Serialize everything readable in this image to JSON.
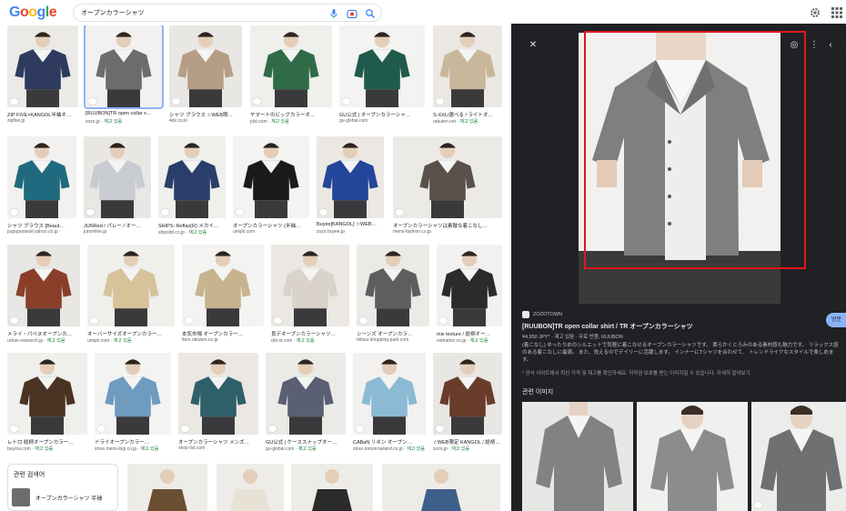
{
  "header": {
    "search_query": "オープンカラーシャツ",
    "icons": [
      "mic-icon",
      "camera-lens-icon",
      "search-icon",
      "settings-icon",
      "apps-icon"
    ]
  },
  "grid": {
    "rows": [
      [
        {
          "caption": "ZIP FIVE×KANGOL半袖オ…",
          "source": "zipfive.jp",
          "stock": ""
        },
        {
          "caption": "[RUUBON]TR open collar s…",
          "source": "zozo.jp · ",
          "stock": "재고 있음"
        },
        {
          "caption": "シャツ ブラウス ☆WEB限…",
          "source": "4dx.co.kr",
          "stock": ""
        },
        {
          "caption": "ヤマートのビッグカラーオ…",
          "source": "plst.com · ",
          "stock": "재고 있음"
        },
        {
          "caption": "GU公式 | オープンカラーシャ…",
          "source": "gu-global.com",
          "stock": ""
        },
        {
          "caption": "S-XXL/選べる / ライトオ…",
          "source": "rakuten.net · ",
          "stock": "재고 있음"
        }
      ],
      [
        {
          "caption": "シャツ ブラウス [Beaut…",
          "source": "pupuparasoil.yahoo.co.jp · ",
          "stock": ""
        },
        {
          "caption": "JUNRed / パレー / オー…",
          "source": "junonline.jp",
          "stock": ""
        },
        {
          "caption": "SHIPS: Reflax(R) メカイ…",
          "source": "shipsltd.co.jp · ",
          "stock": "재고 있음"
        },
        {
          "caption": "オープンカラーシャツ (半袖…",
          "source": "uniqlo.com",
          "stock": ""
        },
        {
          "caption": "Buyee[KANGOL] ☆WEB…",
          "source": "zozo.buyee.jp",
          "stock": ""
        },
        {
          "caption": "オープンカラーシャツは素敵な着こなし…",
          "source": "mens-fashion.co.jp",
          "stock": ""
        }
      ],
      [
        {
          "caption": "メライ・パペヌオープンカ…",
          "source": "urban-research.jp · ",
          "stock": "재고 있음"
        },
        {
          "caption": "オーバーサイズオープンカラー…",
          "source": "uniqlo.com · ",
          "stock": "재고 있음"
        },
        {
          "caption": "本気市場 オープンカラー…",
          "source": "item.rakuten.co.jp",
          "stock": ""
        },
        {
          "caption": "良デオープンカラーシャツ…",
          "source": "dot-st.com · ",
          "stock": "재고 있음"
        },
        {
          "caption": "シーンズ オープンカラ…",
          "source": "mitsui-shopping-park.com",
          "stock": ""
        },
        {
          "caption": "mix texture / 総柄オー…",
          "source": "estnation.co.jp · ",
          "stock": "재고 있음"
        }
      ],
      [
        {
          "caption": "レトロ 総柄オープンカラー…",
          "source": "buyma.com · ",
          "stock": "재고 있음"
        },
        {
          "caption": "ドライオープンカラー…",
          "source": "store.mens-bigi.co.jp · ",
          "stock": "재고 있음"
        },
        {
          "caption": "オープンカラーシャツ メンズ…",
          "source": "shop-list.com",
          "stock": ""
        },
        {
          "caption": "GU公式 | ケーススナップオー…",
          "source": "gu-global.com · ",
          "stock": "재고 있음"
        },
        {
          "caption": "CABaN リネン オープン…",
          "source": "store.tomorrowland.co.jp · ",
          "stock": "재고 있음"
        },
        {
          "caption": "☆WEB限定 KANGOL / 総柄…",
          "source": "zozo.jp · ",
          "stock": "재고 있음"
        }
      ]
    ],
    "related_label": "관련 검색어",
    "related_item": "オープンカラーシャツ 半袖"
  },
  "panel": {
    "site_name": "ZOZOTOWN",
    "title": "[RUUBON]TR open collar shirt / TR オープンカラーシャツ",
    "price_line": "¥4,950 JPY* · 재고 있음 · 무료 반품, RUUBON",
    "description": "(着こなし) ゆったりめのシルエットで気軽に着こなせるオープンカラーシャツです。 柔らかくとろみのある素材感も魅力です。 リラックス感のある着こなしに最適。 また、洗えるのでデイリーに活躍します。 インナーにTシャツを合わせて、 トレンドライクなスタイルで楽しめます。",
    "notice": "* 공식 사이트에서 최신 가격 및 재고를 확인하세요. 저작권 보호를 받는 이미지일 수 있습니다. 자세히 알아보기",
    "visit_button": "방문",
    "related_images_label": "관련 이미지"
  },
  "colors": {
    "panel_bg": "#202124",
    "highlight_box": "#e0161b",
    "stock_green": "#188038",
    "visit_button": "#8ab4f8"
  }
}
